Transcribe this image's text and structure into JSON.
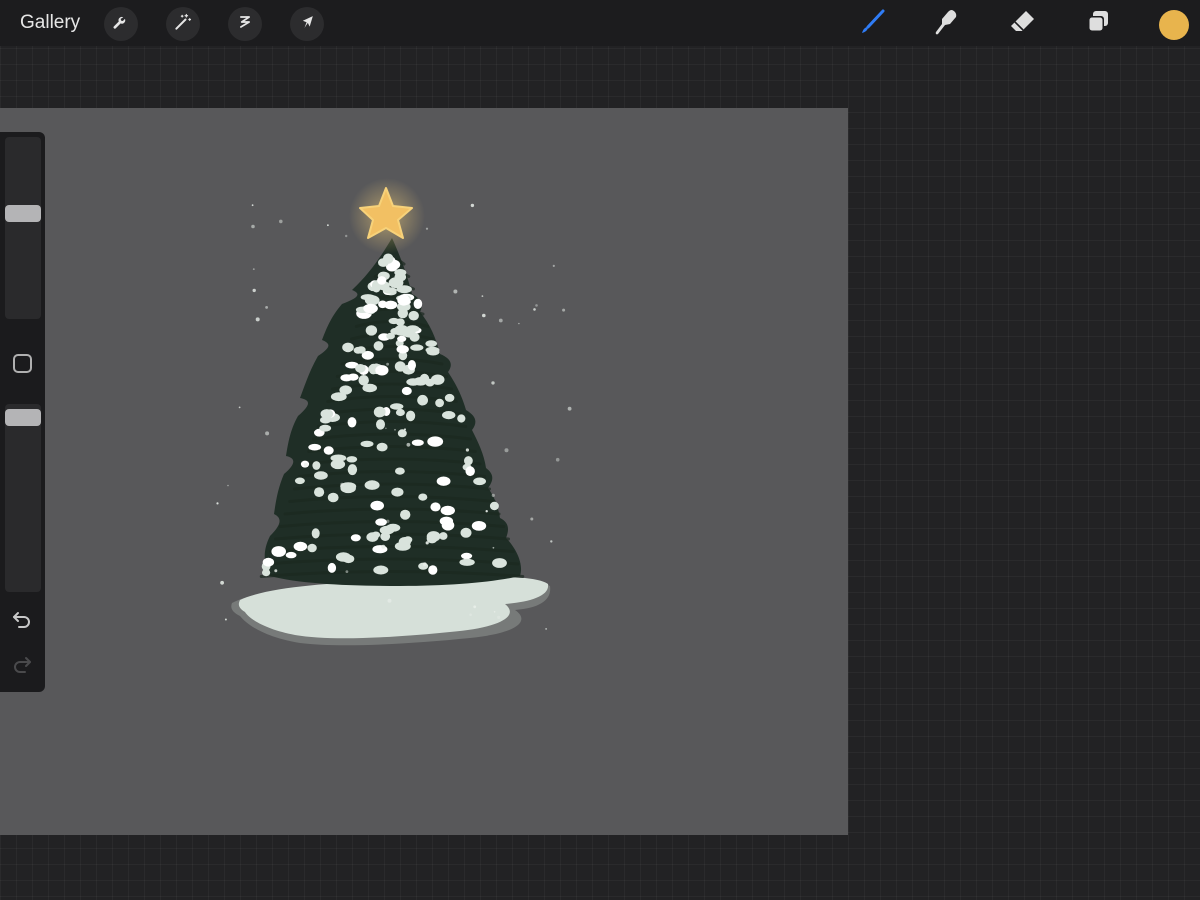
{
  "topbar": {
    "gallery_label": "Gallery",
    "left_tools": [
      {
        "name": "actions",
        "icon": "wrench-icon"
      },
      {
        "name": "adjustments",
        "icon": "magic-wand-icon"
      },
      {
        "name": "selection",
        "icon": "selection-icon"
      },
      {
        "name": "transform",
        "icon": "arrow-cursor-icon"
      }
    ],
    "right_tools": [
      {
        "name": "brush",
        "icon": "brush-icon",
        "active": true
      },
      {
        "name": "smudge",
        "icon": "smudge-finger-icon",
        "active": false
      },
      {
        "name": "eraser",
        "icon": "eraser-icon",
        "active": false
      },
      {
        "name": "layers",
        "icon": "layers-icon",
        "active": false
      }
    ],
    "current_color": "#e8b44d"
  },
  "colors": {
    "accent_active_tool": "#2f7cf6",
    "canvas_background": "#58585a",
    "tree_green": "#1f2e26",
    "snow": "#d9e3dc",
    "star": "#f2c063"
  },
  "sidebar": {
    "brush_size_level": 0.42,
    "opacity_level": 0.05,
    "modify_button_icon": "square-icon",
    "undo_icon": "undo-icon",
    "redo_icon": "redo-icon",
    "redo_enabled": false
  },
  "canvas": {
    "artwork": "snowy-christmas-tree-with-star"
  }
}
